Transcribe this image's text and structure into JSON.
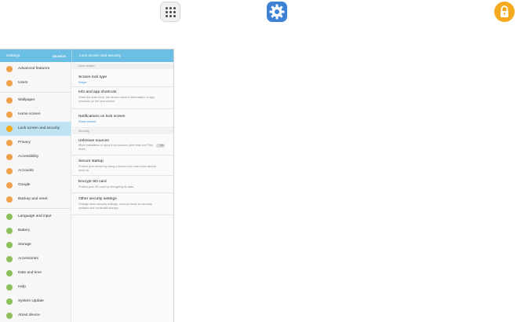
{
  "colors": {
    "appbar": "#6bbfe4",
    "active_item": "#bfe3f3",
    "link_text": "#3a8fd6",
    "settings_icon_bg": "#3e82d6",
    "lock_icon_bg": "#f5a91e"
  },
  "top_icons": [
    "apps-icon",
    "settings-gear-icon",
    "lock-icon"
  ],
  "appbar": {
    "title": "Settings",
    "search": "SEARCH",
    "page_title": "Lock screen and security"
  },
  "sidebar": {
    "items": [
      {
        "label": "Advanced features",
        "icon": "advanced-features-icon",
        "color": "#f0a04b"
      },
      {
        "label": "Users",
        "icon": "users-icon",
        "color": "#f0a04b"
      },
      {
        "label": "Wallpaper",
        "icon": "wallpaper-icon",
        "color": "#f0a04b"
      },
      {
        "label": "Home screen",
        "icon": "home-screen-icon",
        "color": "#f0a04b"
      },
      {
        "label": "Lock screen and security",
        "icon": "lock-icon",
        "color": "#f5a91e"
      },
      {
        "label": "Privacy",
        "icon": "privacy-icon",
        "color": "#f0a04b"
      },
      {
        "label": "Accessibility",
        "icon": "accessibility-icon",
        "color": "#f0a04b"
      },
      {
        "label": "Accounts",
        "icon": "accounts-icon",
        "color": "#f0a04b"
      },
      {
        "label": "Google",
        "icon": "google-icon",
        "color": "#f0a04b"
      },
      {
        "label": "Backup and reset",
        "icon": "backup-icon",
        "color": "#f0a04b"
      },
      {
        "label": "Language and input",
        "icon": "language-icon",
        "color": "#8dbf5b"
      },
      {
        "label": "Battery",
        "icon": "battery-icon",
        "color": "#8dbf5b"
      },
      {
        "label": "Storage",
        "icon": "storage-icon",
        "color": "#8dbf5b"
      },
      {
        "label": "Accessories",
        "icon": "accessories-icon",
        "color": "#8dbf5b"
      },
      {
        "label": "Date and time",
        "icon": "date-time-icon",
        "color": "#8dbf5b"
      },
      {
        "label": "Help",
        "icon": "help-icon",
        "color": "#8dbf5b"
      },
      {
        "label": "System Update",
        "icon": "system-update-icon",
        "color": "#8dbf5b"
      },
      {
        "label": "About device",
        "icon": "about-device-icon",
        "color": "#8dbf5b"
      }
    ]
  },
  "detail": {
    "section_lock": "Lock screen",
    "screen_lock_type": {
      "title": "Screen lock type",
      "sub": "Swipe"
    },
    "info_shortcuts": {
      "title": "Info and app shortcuts",
      "sub": "Show the dual clock, the device owner's information, or app shortcuts on the lock screen."
    },
    "notifications": {
      "title": "Notifications on lock screen",
      "sub": "Show content"
    },
    "section_security": "Security",
    "unknown_sources": {
      "title": "Unknown sources",
      "sub": "Allow installation of apps from sources other than the Play Store.",
      "toggle": "OFF"
    },
    "secure_startup": {
      "title": "Secure startup",
      "sub": "Protect your device by using a screen lock when your device turns on."
    },
    "encrypt_sd": {
      "title": "Encrypt SD card",
      "sub": "Protect your SD card by encrypting its data."
    },
    "other_security": {
      "title": "Other security settings",
      "sub": "Change other security settings, such as those for security updates and credential storage."
    }
  }
}
